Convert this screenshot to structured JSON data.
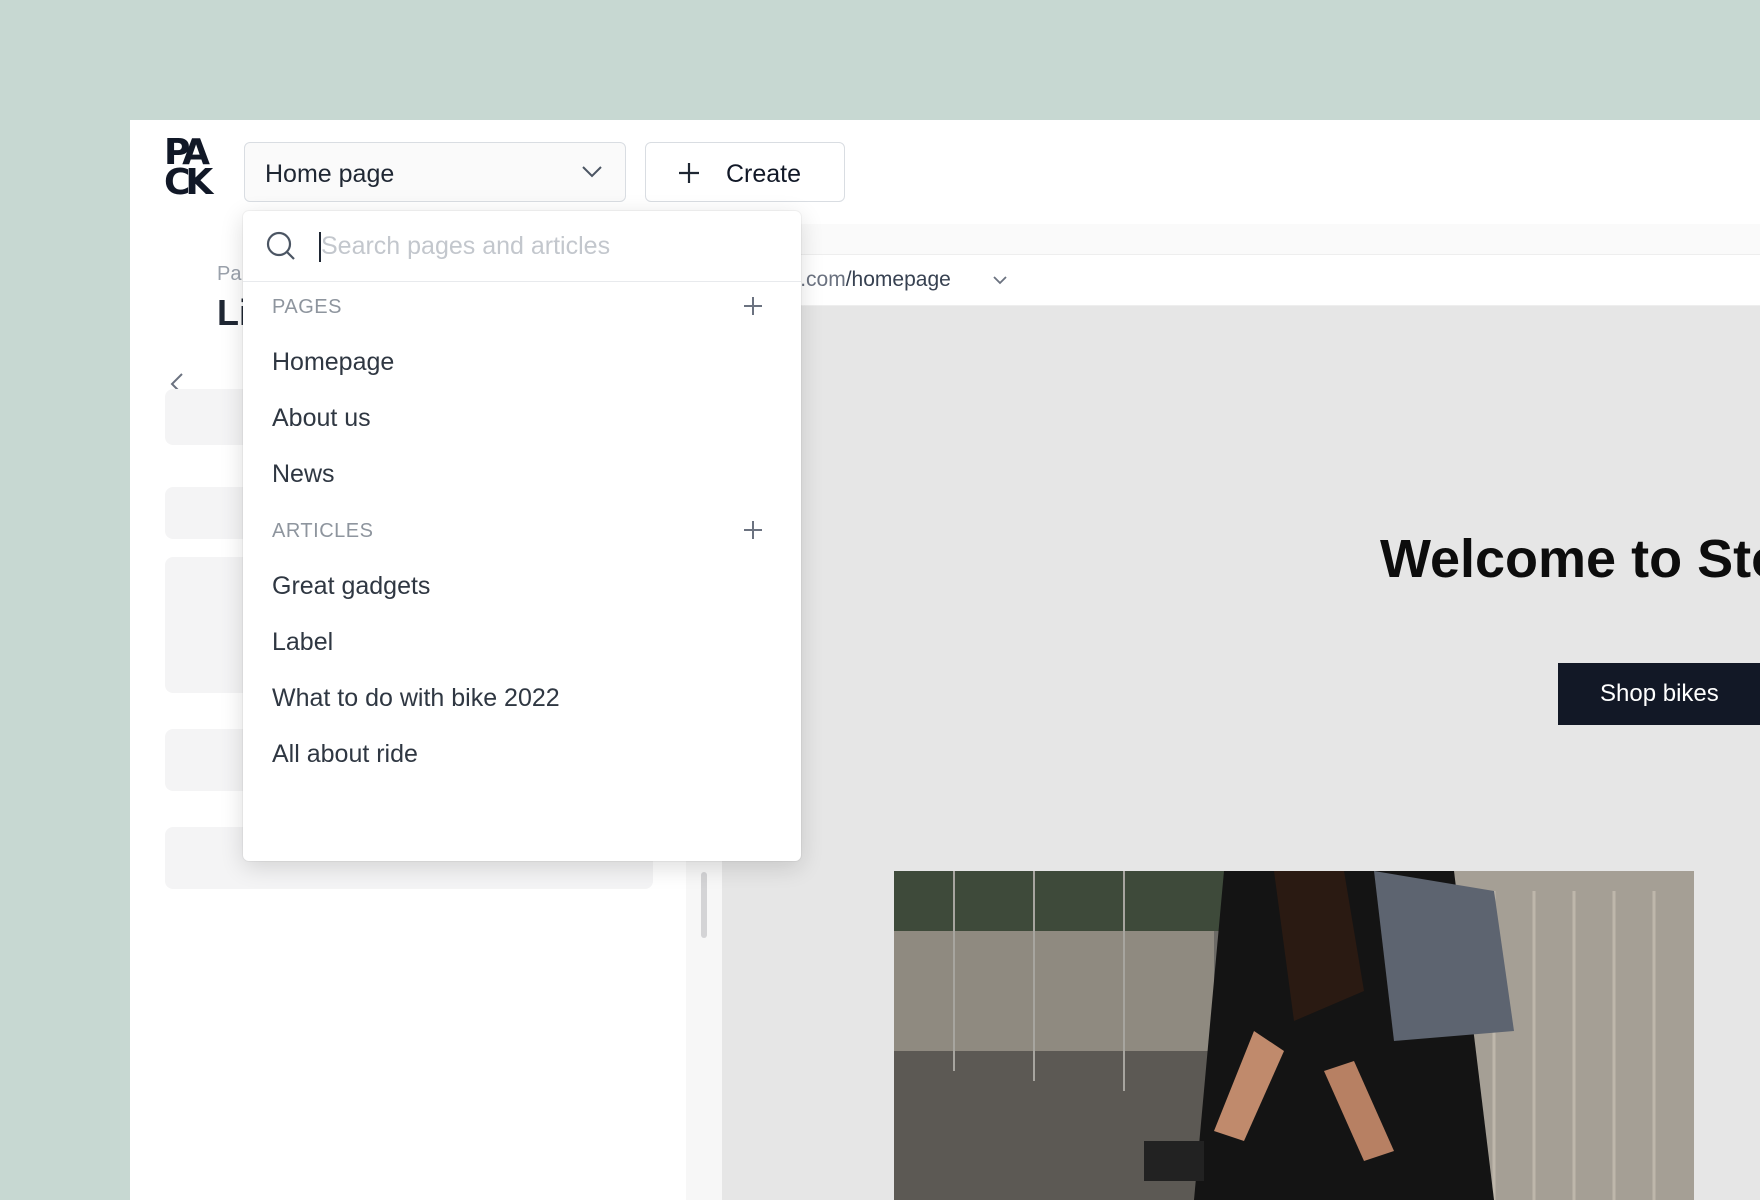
{
  "topbar": {
    "logo_text": "PACK",
    "page_select": {
      "value": "Home page",
      "icon": "chevron-down-icon"
    },
    "create_button": {
      "label": "Create",
      "icon": "plus-icon"
    }
  },
  "left_panel": {
    "breadcrumb": "Pa",
    "title": "Li",
    "back_icon": "chevron-left-icon"
  },
  "preview": {
    "url_prefix": "torefront.com",
    "url_path": "/homepage",
    "hero_title": "Welcome to Sto",
    "cta_label": "Shop bikes"
  },
  "dropdown": {
    "search": {
      "placeholder": "Search pages and articles",
      "value": ""
    },
    "pages": {
      "header": "PAGES",
      "items": [
        "Homepage",
        "About us",
        "News"
      ]
    },
    "articles": {
      "header": "ARTICLES",
      "items": [
        "Great gadgets",
        "Label",
        "What to do with bike 2022",
        "All about ride"
      ]
    }
  },
  "colors": {
    "backdrop": "#c7d8d2",
    "cta_bg": "#121826",
    "text_primary": "#1f2733",
    "text_muted": "#8e959e"
  }
}
